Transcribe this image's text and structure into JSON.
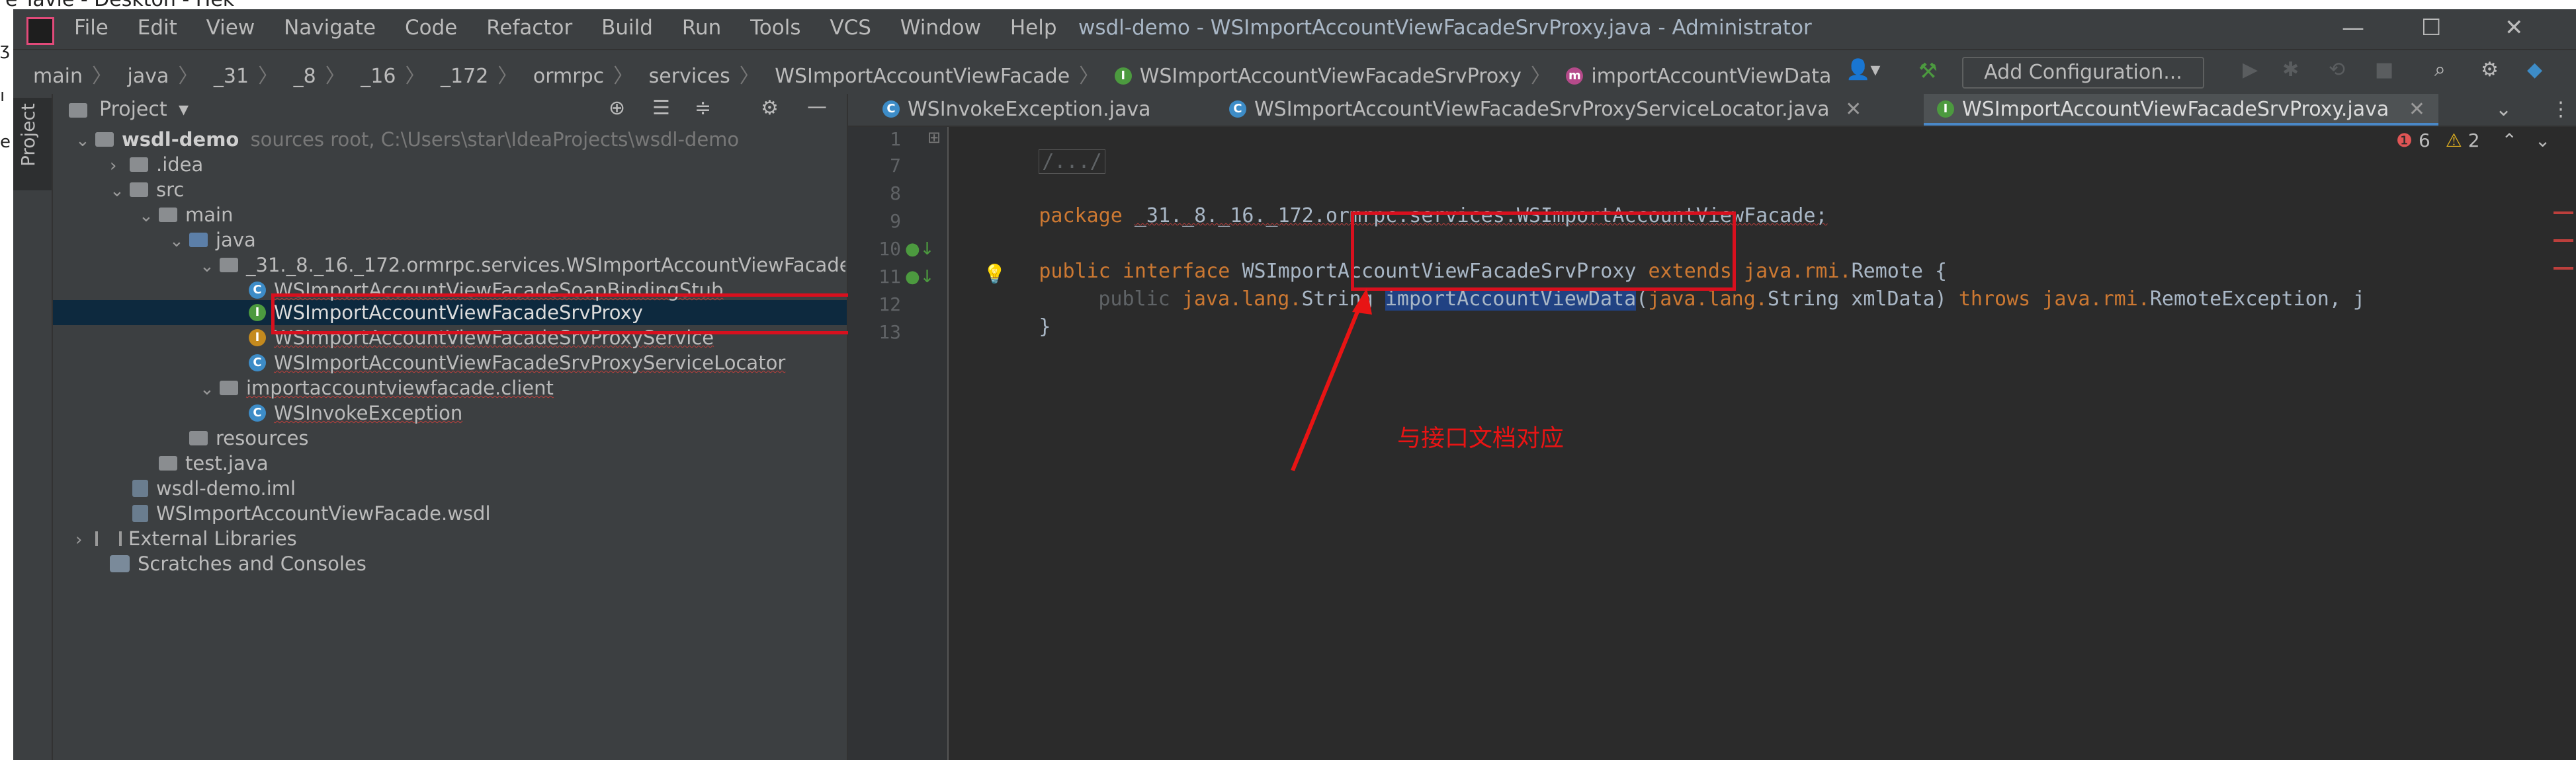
{
  "top_fragment": {
    "line1": "e Tavle - Deskton - Hek",
    "left_chars": [
      "ʒ",
      "ı",
      "ɔ",
      "e"
    ]
  },
  "window": {
    "menu": [
      "File",
      "Edit",
      "View",
      "Navigate",
      "Code",
      "Refactor",
      "Build",
      "Run",
      "Tools",
      "VCS",
      "Window",
      "Help"
    ],
    "title": "wsdl-demo - WSImportAccountViewFacadeSrvProxy.java - Administrator",
    "controls": {
      "minimize": "—",
      "maximize": "☐",
      "close": "✕"
    }
  },
  "breadcrumbs": [
    "main",
    "java",
    "_31",
    "_8",
    "_16",
    "_172",
    "ormrpc",
    "services",
    "WSImportAccountViewFacade",
    "WSImportAccountViewFacadeSrvProxy",
    "importAccountViewData"
  ],
  "toolbar": {
    "run_config_label": "Add Configuration...",
    "user_icon": "user-icon",
    "hammer_icon": "hammer-icon"
  },
  "project_panel": {
    "title": "Project",
    "tool_strip_label": "Project",
    "tree": [
      {
        "label": "wsdl-demo",
        "suffix": "sources root, C:\\Users\\star\\IdeaProjects\\wsdl-demo",
        "bold": true
      },
      {
        "label": ".idea"
      },
      {
        "label": "src"
      },
      {
        "label": "main"
      },
      {
        "label": "java"
      },
      {
        "label": "_31._8._16._172.ormrpc.services.WSImportAccountViewFacade"
      },
      {
        "label": "WSImportAccountViewFacadeSoapBindingStub"
      },
      {
        "label": "WSImportAccountViewFacadeSrvProxy"
      },
      {
        "label": "WSImportAccountViewFacadeSrvProxyService"
      },
      {
        "label": "WSImportAccountViewFacadeSrvProxyServiceLocator"
      },
      {
        "label": "importaccountviewfacade.client"
      },
      {
        "label": "WSInvokeException"
      },
      {
        "label": "resources"
      },
      {
        "label": "test.java"
      },
      {
        "label": "wsdl-demo.iml"
      },
      {
        "label": "WSImportAccountViewFacade.wsdl"
      },
      {
        "label": "External Libraries"
      },
      {
        "label": "Scratches and Consoles"
      }
    ]
  },
  "editor_tabs": [
    {
      "label": "WSInvokeException.java"
    },
    {
      "label": "WSImportAccountViewFacadeSrvProxyServiceLocator.java"
    },
    {
      "label": "WSImportAccountViewFacadeSrvProxy.java"
    }
  ],
  "inspections": {
    "errors": "6",
    "warnings": "2"
  },
  "code": {
    "lines": [
      "1",
      "7",
      "8",
      "9",
      "10",
      "11",
      "12",
      "13"
    ],
    "fold": "/.../",
    "package_kw": "package",
    "package_name": "_31._8._16._172.ormrpc.services.WSImportAccountViewFacade;",
    "iface_public": "public",
    "iface_kw": "interface",
    "iface_name": "WSImportAccountViewFacadeSrvProxy",
    "extends_kw": "extends",
    "iface_super_pkg": "java.rmi.",
    "iface_super": "Remote {",
    "m_public": "public",
    "m_type_pkg": "java.lang.",
    "m_type": "String",
    "m_name": "importAccountViewData",
    "m_param_paren": "(",
    "m_param_pkg": "java.lang.",
    "m_param": "String xmlData)",
    "m_throws": "throws",
    "m_ex_pkg": "java.rmi.",
    "m_ex": "RemoteException,",
    "m_tail": " j",
    "closing": "}"
  },
  "annotation": {
    "text": "与接口文档对应"
  },
  "colors": {
    "highlight_red": "#d8101e",
    "selection": "#214283",
    "keyword": "#cc7832"
  }
}
